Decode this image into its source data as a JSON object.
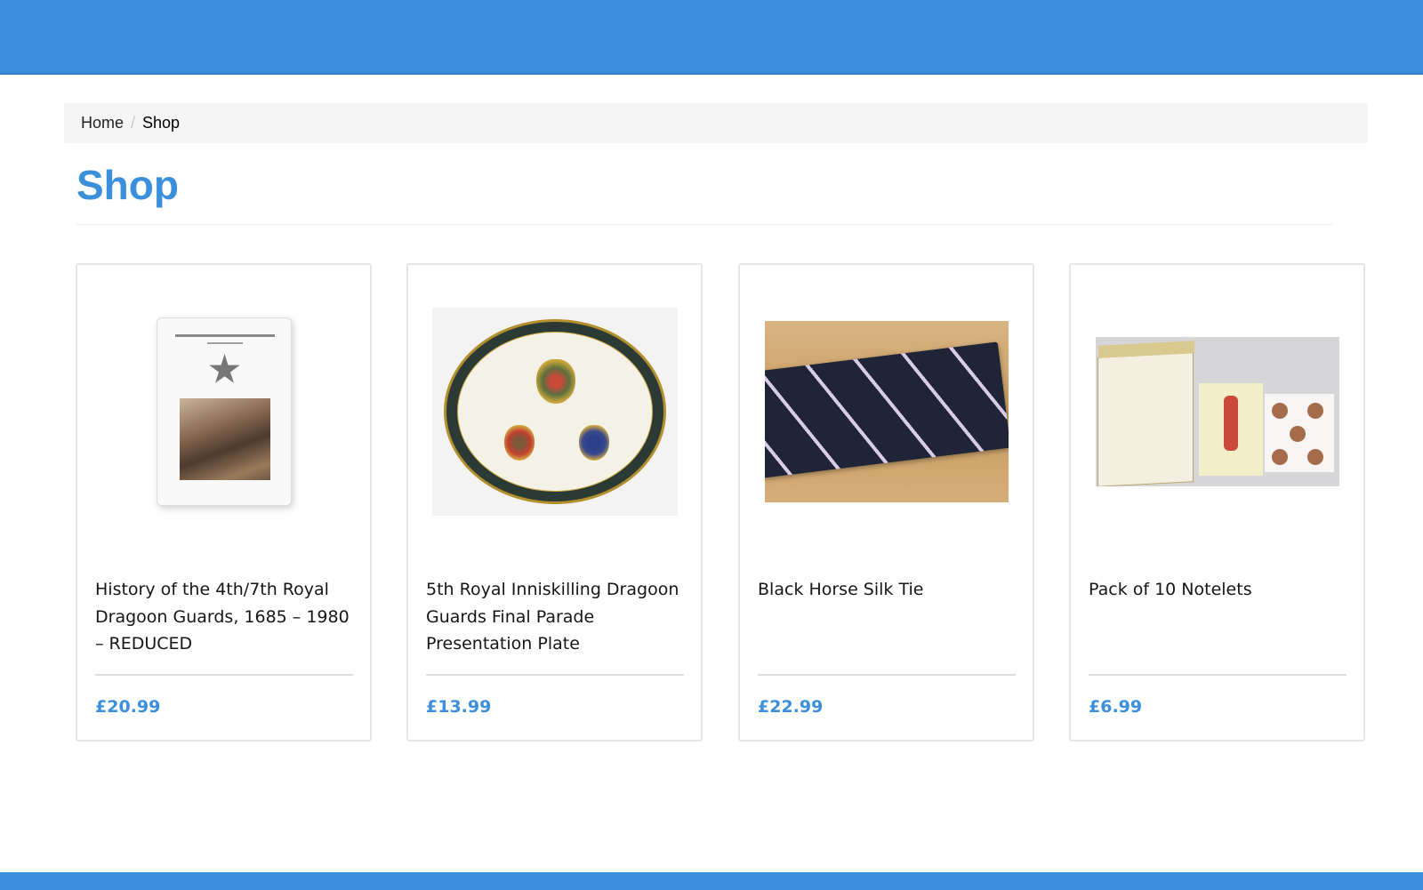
{
  "breadcrumb": {
    "home": "Home",
    "separator": "/",
    "current": "Shop"
  },
  "page": {
    "title": "Shop"
  },
  "products": [
    {
      "name": "History of the 4th/7th Royal Dragoon Guards, 1685 – 1980 – REDUCED",
      "price": "£20.99",
      "image_icon": "book-image"
    },
    {
      "name": "5th Royal Inniskilling Dragoon Guards Final Parade Presentation Plate",
      "price": "£13.99",
      "image_icon": "plate-image"
    },
    {
      "name": "Black Horse Silk Tie",
      "price": "£22.99",
      "image_icon": "tie-image"
    },
    {
      "name": "Pack of 10 Notelets",
      "price": "£6.99",
      "image_icon": "notelets-image"
    }
  ],
  "colors": {
    "accent": "#3b8fdb",
    "breadcrumb_bg": "#f5f5f5",
    "card_border": "#e6e6e6"
  }
}
